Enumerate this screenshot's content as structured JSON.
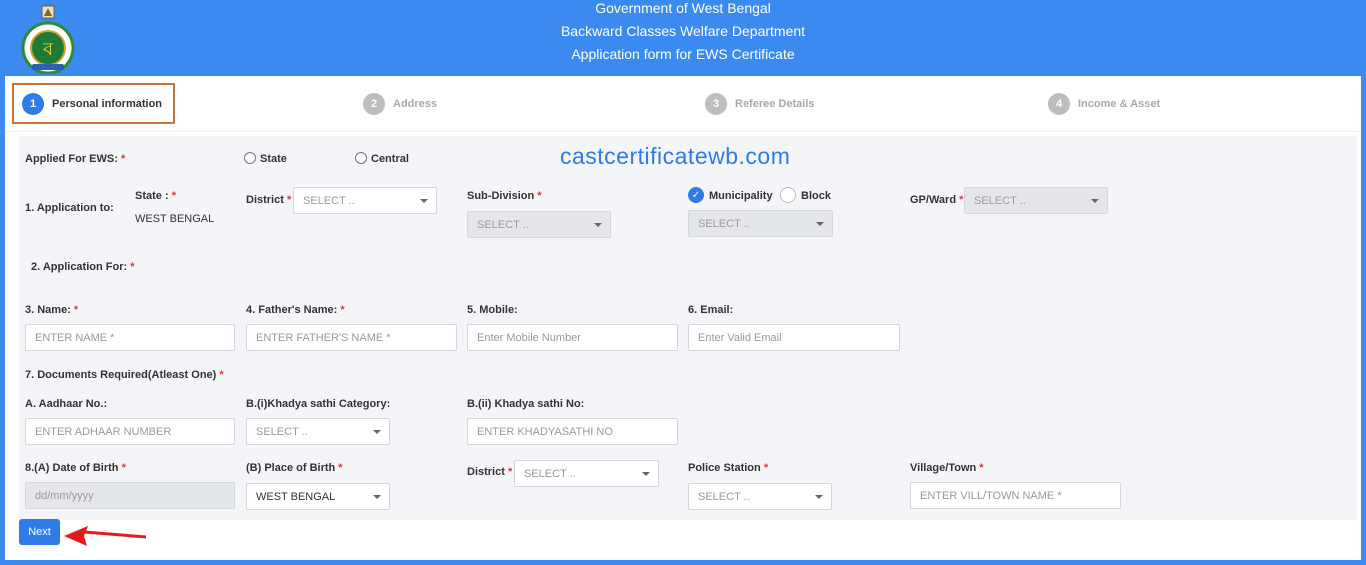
{
  "header": {
    "line1": "Government of West Bengal",
    "line2": "Backward Classes Welfare Department",
    "line3": "Application form for EWS Certificate",
    "bg_color": "#3b8af0"
  },
  "steps": [
    {
      "number": "1",
      "label": "Personal information",
      "active": true
    },
    {
      "number": "2",
      "label": "Address",
      "active": false
    },
    {
      "number": "3",
      "label": "Referee Details",
      "active": false
    },
    {
      "number": "4",
      "label": "Income & Asset",
      "active": false
    }
  ],
  "watermark": "castcertificatewb.com",
  "applied_for": {
    "label": "Applied For EWS:",
    "options": [
      "State",
      "Central"
    ]
  },
  "application_to": {
    "label": "1. Application to:",
    "state_label": "State :",
    "state_value": "WEST BENGAL",
    "district_label": "District",
    "district_placeholder": "SELECT ..",
    "subdivision_label": "Sub-Division",
    "subdivision_placeholder": "SELECT ..",
    "municipality_label": "Municipality",
    "block_label": "Block",
    "municipality_placeholder": "SELECT ..",
    "gpward_label": "GP/Ward",
    "gpward_placeholder": "SELECT .."
  },
  "application_for": {
    "label": "2. Application For:"
  },
  "name": {
    "label": "3. Name:",
    "placeholder": "ENTER NAME *"
  },
  "father": {
    "label": "4. Father's Name:",
    "placeholder": "ENTER FATHER'S NAME *"
  },
  "mobile": {
    "label": "5. Mobile:",
    "placeholder": "Enter Mobile Number"
  },
  "email": {
    "label": "6. Email:",
    "placeholder": "Enter Valid Email"
  },
  "documents": {
    "label": "7. Documents Required(Atleast One)"
  },
  "aadhaar": {
    "label": "A. Aadhaar No.:",
    "placeholder": "ENTER ADHAAR NUMBER"
  },
  "khadya_category": {
    "label": "B.(i)Khadya sathi Category:",
    "placeholder": "SELECT .."
  },
  "khadya_no": {
    "label": "B.(ii) Khadya sathi No:",
    "placeholder": "ENTER KHADYASATHI NO"
  },
  "dob": {
    "label": "8.(A) Date of Birth",
    "placeholder": "dd/mm/yyyy"
  },
  "place_of_birth": {
    "label": "(B) Place of Birth",
    "value": "WEST BENGAL"
  },
  "birth_district": {
    "label": "District",
    "placeholder": "SELECT .."
  },
  "police_station": {
    "label": "Police Station",
    "placeholder": "SELECT .."
  },
  "village": {
    "label": "Village/Town",
    "placeholder": "ENTER VILL/TOWN NAME *"
  },
  "next_button": "Next",
  "required_mark": "*",
  "accent_color": "#2f7be8",
  "highlight_color": "#c8753a",
  "arrow_color": "#e31b1b"
}
